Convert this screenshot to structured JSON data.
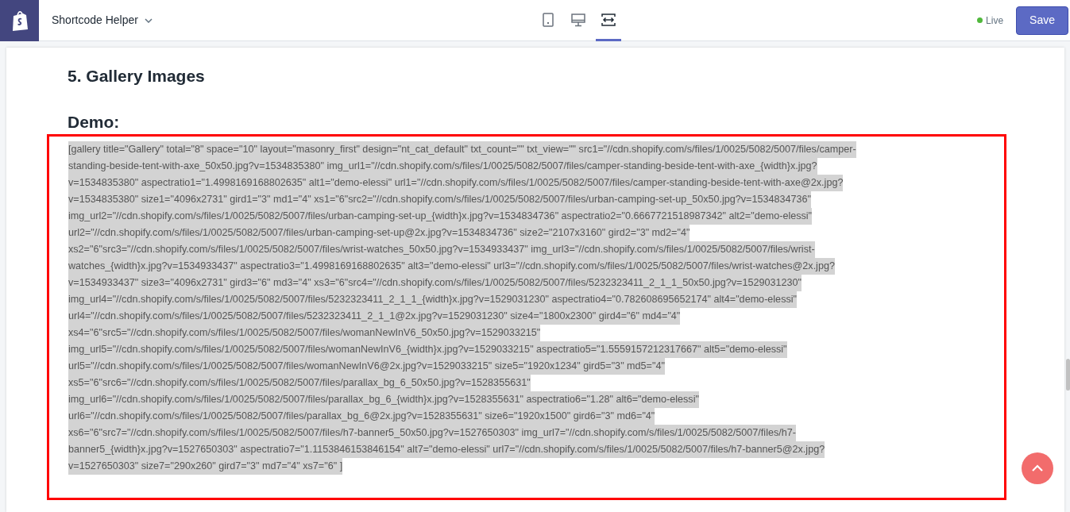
{
  "topbar": {
    "app_title": "Shortcode Helper",
    "views": [
      {
        "kind": "mobile",
        "selected": false
      },
      {
        "kind": "desktop",
        "selected": false
      },
      {
        "kind": "fullwidth",
        "selected": true
      }
    ],
    "status": {
      "label": "Live",
      "color": "#50b83c"
    },
    "save_label": "Save"
  },
  "section": {
    "heading": "5. Gallery Images",
    "subheading": "Demo:",
    "code_lines": [
      "[gallery title=\"Gallery\" total=\"8\" space=\"10\" layout=\"masonry_first\" design=\"nt_cat_default\" txt_count=\"\" txt_view=\"\" src1=\"//cdn.shopify.com/s/files/1/0025/5082/5007/files/camper-",
      "standing-beside-tent-with-axe_50x50.jpg?v=1534835380\" img_url1=\"//cdn.shopify.com/s/files/1/0025/5082/5007/files/camper-standing-beside-tent-with-axe_{width}x.jpg?",
      "v=1534835380\" aspectratio1=\"1.4998169168802635\" alt1=\"demo-elessi\" url1=\"//cdn.shopify.com/s/files/1/0025/5082/5007/files/camper-standing-beside-tent-with-axe@2x.jpg?",
      "v=1534835380\" size1=\"4096x2731\" gird1=\"3\" md1=\"4\" xs1=\"6\"src2=\"//cdn.shopify.com/s/files/1/0025/5082/5007/files/urban-camping-set-up_50x50.jpg?v=1534834736\"",
      "img_url2=\"//cdn.shopify.com/s/files/1/0025/5082/5007/files/urban-camping-set-up_{width}x.jpg?v=1534834736\" aspectratio2=\"0.6667721518987342\" alt2=\"demo-elessi\"",
      "url2=\"//cdn.shopify.com/s/files/1/0025/5082/5007/files/urban-camping-set-up@2x.jpg?v=1534834736\" size2=\"2107x3160\" gird2=\"3\" md2=\"4\"",
      "xs2=\"6\"src3=\"//cdn.shopify.com/s/files/1/0025/5082/5007/files/wrist-watches_50x50.jpg?v=1534933437\" img_url3=\"//cdn.shopify.com/s/files/1/0025/5082/5007/files/wrist-",
      "watches_{width}x.jpg?v=1534933437\" aspectratio3=\"1.4998169168802635\" alt3=\"demo-elessi\" url3=\"//cdn.shopify.com/s/files/1/0025/5082/5007/files/wrist-watches@2x.jpg?",
      "v=1534933437\" size3=\"4096x2731\" gird3=\"6\" md3=\"4\" xs3=\"6\"src4=\"//cdn.shopify.com/s/files/1/0025/5082/5007/files/5232323411_2_1_1_50x50.jpg?v=1529031230\"",
      "img_url4=\"//cdn.shopify.com/s/files/1/0025/5082/5007/files/5232323411_2_1_1_{width}x.jpg?v=1529031230\" aspectratio4=\"0.782608695652174\" alt4=\"demo-elessi\"",
      "url4=\"//cdn.shopify.com/s/files/1/0025/5082/5007/files/5232323411_2_1_1@2x.jpg?v=1529031230\" size4=\"1800x2300\" gird4=\"6\" md4=\"4\"",
      "xs4=\"6\"src5=\"//cdn.shopify.com/s/files/1/0025/5082/5007/files/womanNewInV6_50x50.jpg?v=1529033215\"",
      "img_url5=\"//cdn.shopify.com/s/files/1/0025/5082/5007/files/womanNewInV6_{width}x.jpg?v=1529033215\" aspectratio5=\"1.5559157212317667\" alt5=\"demo-elessi\"",
      "url5=\"//cdn.shopify.com/s/files/1/0025/5082/5007/files/womanNewInV6@2x.jpg?v=1529033215\" size5=\"1920x1234\" gird5=\"3\" md5=\"4\"",
      "xs5=\"6\"src6=\"//cdn.shopify.com/s/files/1/0025/5082/5007/files/parallax_bg_6_50x50.jpg?v=1528355631\"",
      "img_url6=\"//cdn.shopify.com/s/files/1/0025/5082/5007/files/parallax_bg_6_{width}x.jpg?v=1528355631\" aspectratio6=\"1.28\" alt6=\"demo-elessi\"",
      "url6=\"//cdn.shopify.com/s/files/1/0025/5082/5007/files/parallax_bg_6@2x.jpg?v=1528355631\" size6=\"1920x1500\" gird6=\"3\" md6=\"4\"",
      "xs6=\"6\"src7=\"//cdn.shopify.com/s/files/1/0025/5082/5007/files/h7-banner5_50x50.jpg?v=1527650303\" img_url7=\"//cdn.shopify.com/s/files/1/0025/5082/5007/files/h7-",
      "banner5_{width}x.jpg?v=1527650303\" aspectratio7=\"1.1153846153846154\" alt7=\"demo-elessi\" url7=\"//cdn.shopify.com/s/files/1/0025/5082/5007/files/h7-banner5@2x.jpg?",
      "v=1527650303\" size7=\"290x260\" gird7=\"3\" md7=\"4\" xs7=\"6\" ]"
    ]
  }
}
